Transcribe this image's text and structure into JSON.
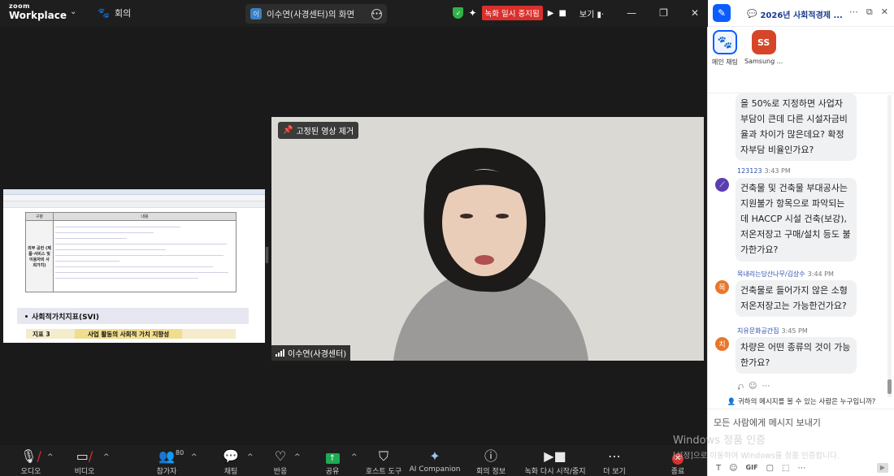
{
  "app": {
    "logo_top": "zoom",
    "logo_bottom": "Workplace",
    "meeting_tab": "회의",
    "share_tab_initial": "이",
    "share_tab_label": "이수연(사경센터)의 화면",
    "recording_status": "녹화 일시 중지됨",
    "view_label": "보기"
  },
  "shared_doc": {
    "header_col1": "구분",
    "header_col2": "내용",
    "left_cell": "외부 공헌 (제품·서비스 및 이용자의 사회가치)",
    "section_title": "사회적가치지표(SVI)",
    "indicator_key": "지표 3",
    "indicator_value": "사업 활동의 사회적 가치 지향성"
  },
  "video": {
    "pin_label": "고정된 영상 제거",
    "participant_name": "이수연(사경센터)"
  },
  "toolbar": {
    "audio": "오디오",
    "video": "비디오",
    "participants": "참가자",
    "participant_count": "80",
    "chat": "채팅",
    "reactions": "반응",
    "share": "공유",
    "host_tools": "호스트 도구",
    "ai_companion": "AI Companion",
    "meeting_info": "회의 정보",
    "record": "녹화 다시 시작/중지",
    "more": "더 보기",
    "end": "종료"
  },
  "chat": {
    "title": "2026년 사회적경제 ...",
    "channels": [
      {
        "name": "메인 채팅",
        "initials": ""
      },
      {
        "name": "Samsung ...",
        "initials": "SS"
      }
    ],
    "messages": [
      {
        "sender": "",
        "time": "",
        "avatar": "",
        "text": "을 50%로 지정하면 사업자 부담이 큰데 다른 시설자금비율과 차이가 많은데요? 확정 자부담 비율인가요?"
      },
      {
        "sender": "123123",
        "time": "3:43 PM",
        "avatar": "",
        "text": "건축물 및 건축물 부대공사는 지원불가 항목으로 파악되는데 HACCP 시설 건축(보강), 저온저장고 구매/설치 등도 불가한가요?"
      },
      {
        "sender": "목내리는당산나무/김상수",
        "time": "3:44 PM",
        "avatar": "목",
        "text": "건축물로 들어가지 않은 소형 저온저장고는 가능한건가요?"
      },
      {
        "sender": "치유문화공간집",
        "time": "3:45 PM",
        "avatar": "치",
        "text": "차량은 어떤 종류의 것이 가능한가요?"
      }
    ],
    "who_can_see": "귀하의 메시지를 볼 수 있는 사람은 누구입니까?",
    "input_placeholder": "모든 사람에게 메시지 보내기",
    "gif_label": "GIF"
  },
  "watermark": {
    "line1": "Windows 정품 인증",
    "line2": "[설정]으로 이동하여 Windows를 정품 인증합니다."
  },
  "colors": {
    "accent": "#0b5cff",
    "recording": "#d9302c",
    "share_green": "#1faa55",
    "avatar_orange": "#e8772a",
    "avatar_purple": "#5b3fb0"
  }
}
